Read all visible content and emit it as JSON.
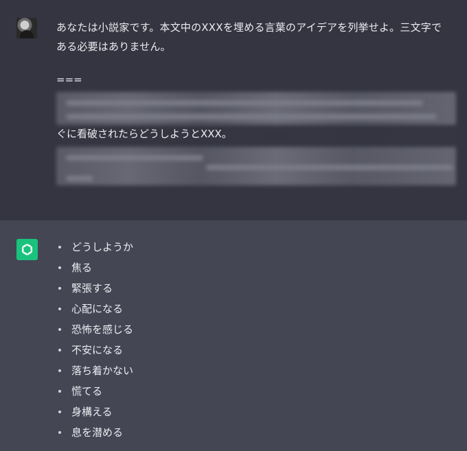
{
  "user_message": {
    "line1": "あなたは小説家です。本文中のXXXを埋める言葉のアイデアを列挙せよ。三文字で",
    "line2": "ある必要はありません。",
    "separator": "===",
    "visible_line": "ぐに看破されたらどうしようとXXX。"
  },
  "assistant_message": {
    "items": [
      "どうしようか",
      "焦る",
      "緊張する",
      "心配になる",
      "恐怖を感じる",
      "不安になる",
      "落ち着かない",
      "慌てる",
      "身構える",
      "息を潜める"
    ]
  },
  "colors": {
    "user_bg": "#343541",
    "assistant_bg": "#444654",
    "bot_avatar": "#19c37d",
    "text": "#ececf1"
  },
  "icons": {
    "user_avatar": "user-avatar",
    "bot_avatar": "openai-logo-icon"
  }
}
